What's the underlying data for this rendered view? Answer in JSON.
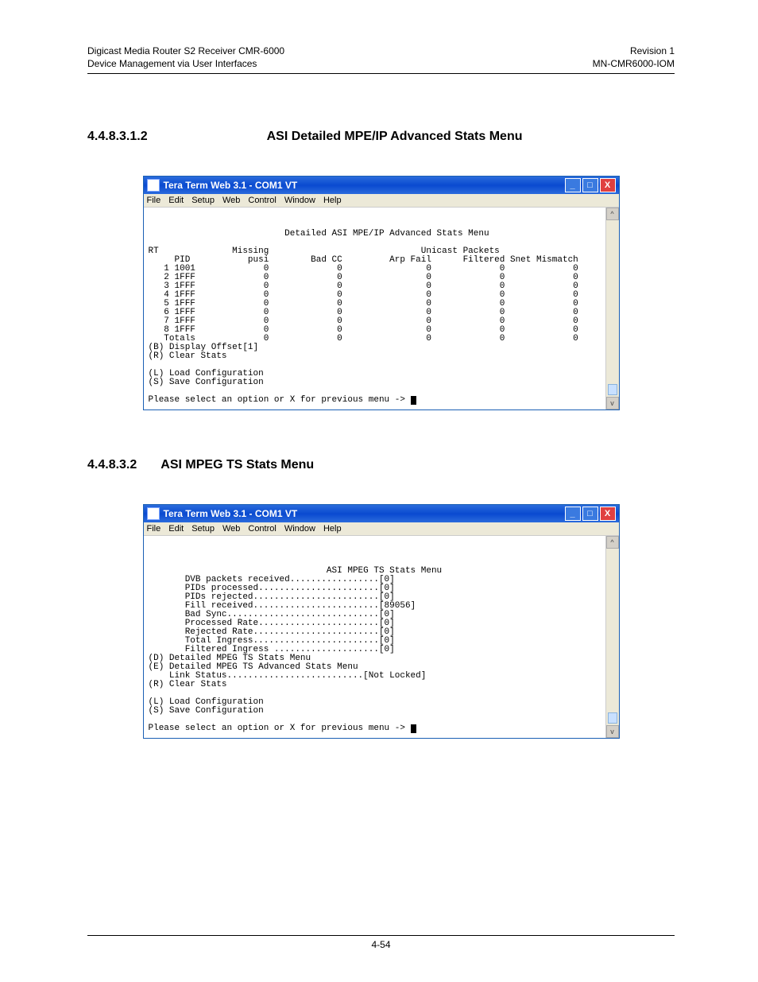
{
  "doc_header": {
    "left_line1": "Digicast Media Router S2 Receiver CMR-6000",
    "left_line2": "Device Management via User Interfaces",
    "right_line1": "Revision 1",
    "right_line2": "MN-CMR6000-IOM"
  },
  "section1": {
    "number": "4.4.8.3.1.2",
    "title": "ASI Detailed MPE/IP Advanced Stats Menu"
  },
  "section2": {
    "number": "4.4.8.3.2",
    "title": "ASI MPEG TS Stats Menu"
  },
  "window": {
    "app_title": "Tera Term Web 3.1 - COM1 VT",
    "menus": {
      "file": "File",
      "edit": "Edit",
      "setup": "Setup",
      "web": "Web",
      "control": "Control",
      "window": "Window",
      "help": "Help"
    },
    "win_buttons": {
      "min_glyph": "_",
      "max_glyph": "□",
      "close_glyph": "X"
    },
    "scroll_glyphs": {
      "up": "^",
      "down": "v"
    }
  },
  "terminal1": {
    "title_line": "                          Detailed ASI MPE/IP Advanced Stats Menu",
    "blank": "",
    "header_line1": "RT              Missing                             Unicast Packets",
    "header_line2": "     PID           pusi        Bad CC         Arp Fail      Filtered Snet Mismatch",
    "rows": [
      "   1 1001             0             0                0             0             0",
      "   2 1FFF             0             0                0             0             0",
      "   3 1FFF             0             0                0             0             0",
      "   4 1FFF             0             0                0             0             0",
      "   5 1FFF             0             0                0             0             0",
      "   6 1FFF             0             0                0             0             0",
      "   7 1FFF             0             0                0             0             0",
      "   8 1FFF             0             0                0             0             0",
      "   Totals             0             0                0             0             0"
    ],
    "opt_b": "(B) Display Offset[1]",
    "opt_r": "(R) Clear Stats",
    "opt_l": "(L) Load Configuration",
    "opt_s": "(S) Save Configuration",
    "prompt": "Please select an option or X for previous menu -> "
  },
  "terminal2": {
    "title_line": "                                  ASI MPEG TS Stats Menu",
    "lines": [
      "       DVB packets received.................[0]",
      "       PIDs processed.......................[0]",
      "       PIDs rejected........................[0]",
      "       Fill received........................[89056]",
      "       Bad Sync.............................[0]",
      "       Processed Rate.......................[0]",
      "       Rejected Rate........................[0]",
      "       Total Ingress........................[0]",
      "       Filtered Ingress ....................[0]"
    ],
    "opt_d": "(D) Detailed MPEG TS Stats Menu",
    "opt_e": "(E) Detailed MPEG TS Advanced Stats Menu",
    "link_status": "    Link Status..........................[Not Locked]",
    "opt_r": "(R) Clear Stats",
    "opt_l": "(L) Load Configuration",
    "opt_s": "(S) Save Configuration",
    "prompt": "Please select an option or X for previous menu -> "
  },
  "footer": {
    "page_number": "4-54"
  }
}
